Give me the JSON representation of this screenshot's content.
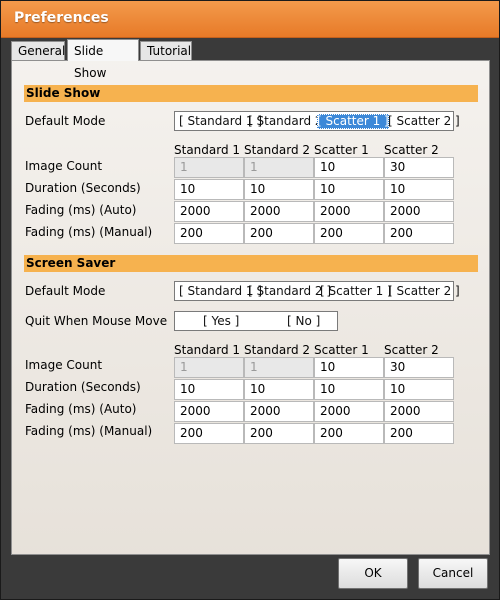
{
  "window": {
    "title": "Preferences"
  },
  "tabs": [
    {
      "label": "General"
    },
    {
      "label": "Slide Show"
    },
    {
      "label": "Tutorial"
    }
  ],
  "slideshow": {
    "header": "Slide Show",
    "default_mode_label": "Default Mode",
    "modes": [
      "[ Standard 1 ]",
      "[ Standard 2 ]",
      "[ Scatter 1 ]",
      "[ Scatter 2 ]"
    ],
    "selected_mode": "[ Scatter 1 ]",
    "columns": [
      "Standard 1",
      "Standard 2",
      "Scatter 1",
      "Scatter 2"
    ],
    "rows": [
      {
        "label": "Image Count",
        "values": [
          "1",
          "1",
          "10",
          "30"
        ]
      },
      {
        "label": "Duration (Seconds)",
        "values": [
          "10",
          "10",
          "10",
          "10"
        ]
      },
      {
        "label": "Fading (ms) (Auto)",
        "values": [
          "2000",
          "2000",
          "2000",
          "2000"
        ]
      },
      {
        "label": "Fading (ms) (Manual)",
        "values": [
          "200",
          "200",
          "200",
          "200"
        ]
      }
    ]
  },
  "screensaver": {
    "header": "Screen Saver",
    "default_mode_label": "Default Mode",
    "modes": [
      "[ Standard 1 ]",
      "[ Standard 2 ]",
      "[ Scatter 1 ]",
      "[ Scatter 2 ]"
    ],
    "quit_label": "Quit When Mouse Move",
    "quit_options": [
      "[ Yes ]",
      "[ No ]"
    ],
    "columns": [
      "Standard 1",
      "Standard 2",
      "Scatter 1",
      "Scatter 2"
    ],
    "rows": [
      {
        "label": "Image Count",
        "values": [
          "1",
          "1",
          "10",
          "30"
        ]
      },
      {
        "label": "Duration (Seconds)",
        "values": [
          "10",
          "10",
          "10",
          "10"
        ]
      },
      {
        "label": "Fading (ms) (Auto)",
        "values": [
          "2000",
          "2000",
          "2000",
          "2000"
        ]
      },
      {
        "label": "Fading (ms) (Manual)",
        "values": [
          "200",
          "200",
          "200",
          "200"
        ]
      }
    ]
  },
  "buttons": {
    "ok": "OK",
    "cancel": "Cancel"
  },
  "colors": {
    "titlebar": "#e77a28",
    "section_header": "#f6b24f",
    "selection": "#3c88d8"
  }
}
